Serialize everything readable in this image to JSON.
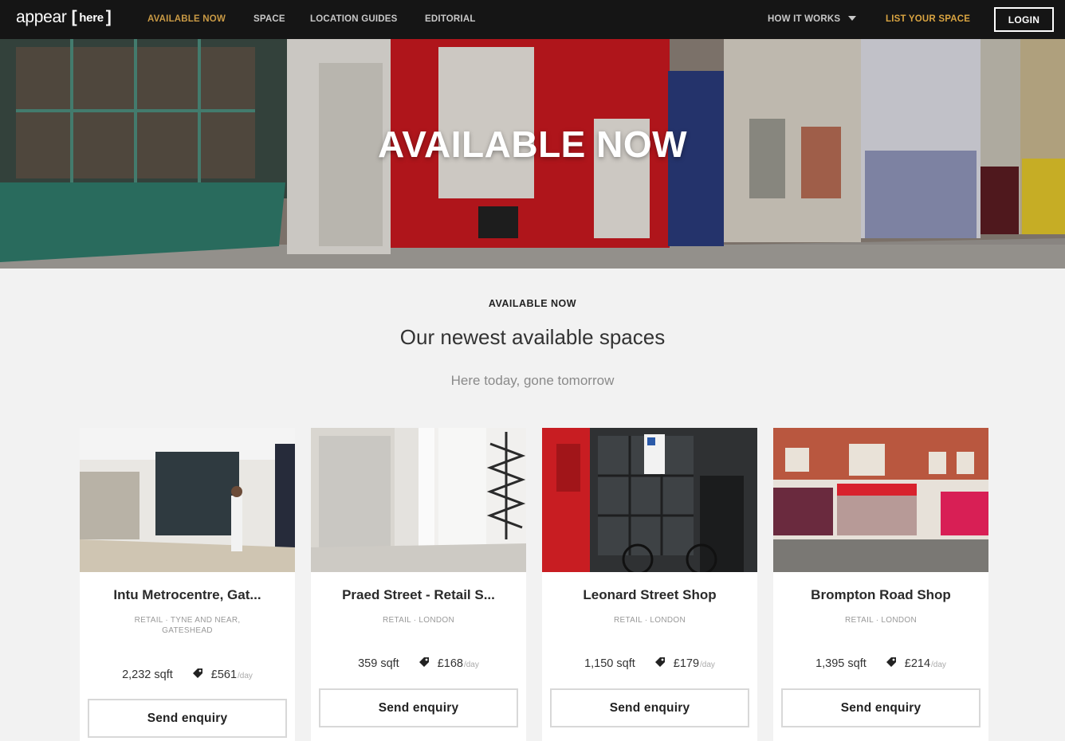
{
  "nav": {
    "logo_word": "appear",
    "logo_here": "here",
    "links": {
      "available_now": "AVAILABLE NOW",
      "space": "SPACE",
      "location_guides": "LOCATION GUIDES",
      "editorial": "EDITORIAL",
      "how_it_works": "HOW IT WORKS",
      "list_your_space": "LIST YOUR SPACE"
    },
    "login": "LOGIN"
  },
  "hero": {
    "title": "AVAILABLE NOW"
  },
  "section": {
    "eyebrow": "AVAILABLE NOW",
    "title": "Our newest available spaces",
    "subtitle": "Here today, gone tomorrow"
  },
  "cards": [
    {
      "title": "Intu Metrocentre, Gat...",
      "meta": "RETAIL · TYNE AND NEAR, GATESHEAD",
      "sqft": "2,232 sqft",
      "price": "£561",
      "per": "/day",
      "button": "Send enquiry"
    },
    {
      "title": "Praed Street - Retail S...",
      "meta": "RETAIL · LONDON",
      "sqft": "359 sqft",
      "price": "£168",
      "per": "/day",
      "button": "Send enquiry"
    },
    {
      "title": "Leonard Street Shop",
      "meta": "RETAIL · LONDON",
      "sqft": "1,150 sqft",
      "price": "£179",
      "per": "/day",
      "button": "Send enquiry"
    },
    {
      "title": "Brompton Road Shop",
      "meta": "RETAIL · LONDON",
      "sqft": "1,395 sqft",
      "price": "£214",
      "per": "/day",
      "button": "Send enquiry"
    }
  ],
  "colors": {
    "nav_bg": "#151515",
    "accent_gold": "#d9a441",
    "page_bg": "#f2f2f2"
  },
  "icons": [
    "price-tag-icon",
    "chevron-down-icon"
  ]
}
